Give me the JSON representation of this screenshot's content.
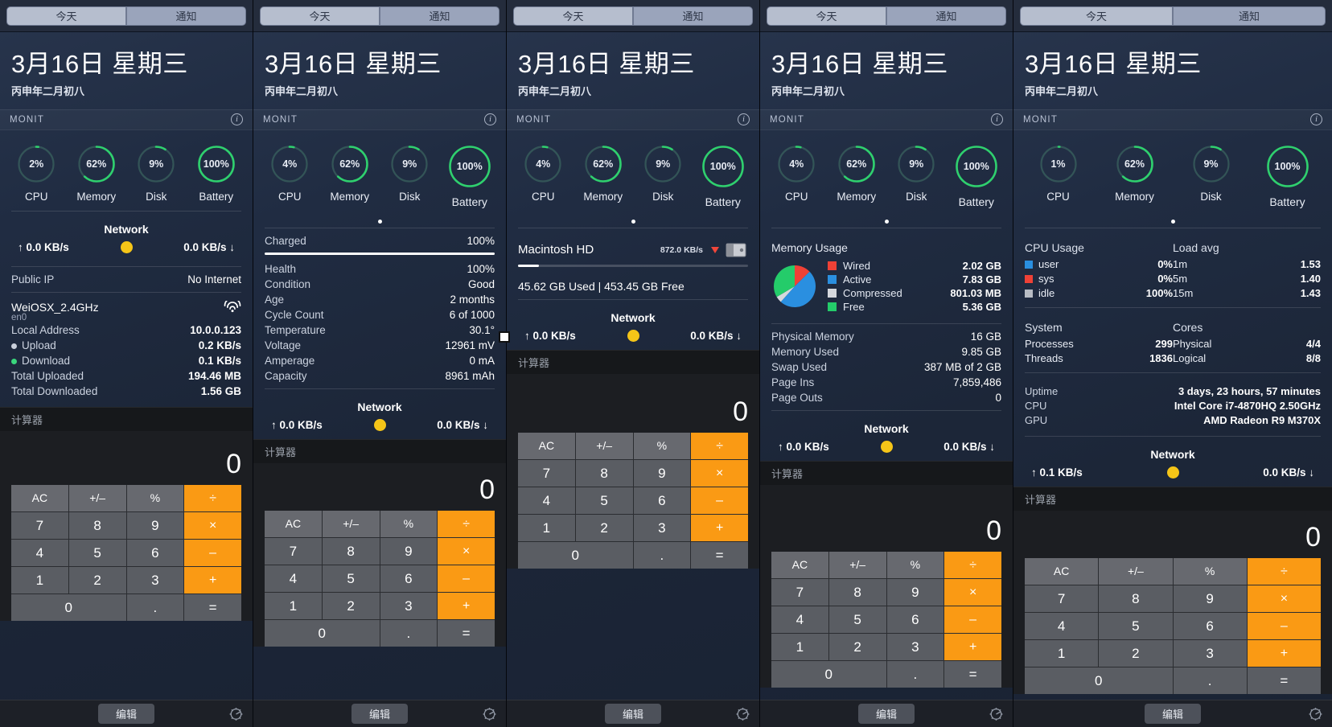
{
  "tabs": {
    "today": "今天",
    "notifications": "通知"
  },
  "date": {
    "main": "3月16日 星期三",
    "lunar": "丙申年二月初八"
  },
  "widget": {
    "name": "MONIT",
    "info_icon": "info-icon"
  },
  "calculator": {
    "title": "计算器",
    "display": "0",
    "keys": [
      "AC",
      "+/–",
      "%",
      "÷",
      "7",
      "8",
      "9",
      "×",
      "4",
      "5",
      "6",
      "–",
      "1",
      "2",
      "3",
      "+",
      "0",
      ".",
      "="
    ]
  },
  "bottom": {
    "edit": "编辑",
    "gear_icon": "gear-icon"
  },
  "common": {
    "network_title": "Network",
    "gauge_labels": [
      "CPU",
      "Memory",
      "Disk",
      "Battery"
    ],
    "orb_color": "#f5c518"
  },
  "panels": [
    {
      "id": "panel-network",
      "gauges": [
        {
          "label": "CPU",
          "value": "2%",
          "pct": 2
        },
        {
          "label": "Memory",
          "value": "62%",
          "pct": 62
        },
        {
          "label": "Disk",
          "value": "9%",
          "pct": 9
        },
        {
          "label": "Battery",
          "value": "100%",
          "pct": 100
        }
      ],
      "network": {
        "up": "↑ 0.0 KB/s",
        "down": "0.0 KB/s ↓"
      },
      "public_ip": {
        "key": "Public IP",
        "value": "No Internet"
      },
      "iface": {
        "ssid": "WeiOSX_2.4GHz",
        "device": "en0",
        "wifi_icon": "wifi-icon",
        "rows": [
          {
            "key": "Local Address",
            "value": "10.0.0.123",
            "dot": ""
          },
          {
            "key": "Upload",
            "value": "0.2 KB/s",
            "dot": "up"
          },
          {
            "key": "Download",
            "value": "0.1 KB/s",
            "dot": "down"
          },
          {
            "key": "Total Uploaded",
            "value": "194.46 MB",
            "dot": ""
          },
          {
            "key": "Total Downloaded",
            "value": "1.56 GB",
            "dot": ""
          }
        ]
      }
    },
    {
      "id": "panel-battery",
      "gauges": [
        {
          "label": "CPU",
          "value": "4%",
          "pct": 4
        },
        {
          "label": "Memory",
          "value": "62%",
          "pct": 62
        },
        {
          "label": "Disk",
          "value": "9%",
          "pct": 9
        },
        {
          "label": "Battery",
          "value": "100%",
          "pct": 100
        }
      ],
      "charged": {
        "key": "Charged",
        "value": "100%",
        "pct": 100
      },
      "rows": [
        {
          "key": "Health",
          "value": "100%"
        },
        {
          "key": "Condition",
          "value": "Good"
        },
        {
          "key": "Age",
          "value": "2 months"
        },
        {
          "key": "Cycle Count",
          "value": "6 of 1000"
        },
        {
          "key": "Temperature",
          "value": "30.1°"
        },
        {
          "key": "Voltage",
          "value": "12961 mV"
        },
        {
          "key": "Amperage",
          "value": "0 mA"
        },
        {
          "key": "Capacity",
          "value": "8961 mAh"
        }
      ],
      "network": {
        "up": "↑ 0.0 KB/s",
        "down": "0.0 KB/s ↓"
      }
    },
    {
      "id": "panel-disk",
      "gauges": [
        {
          "label": "CPU",
          "value": "4%",
          "pct": 4
        },
        {
          "label": "Memory",
          "value": "62%",
          "pct": 62
        },
        {
          "label": "Disk",
          "value": "9%",
          "pct": 9
        },
        {
          "label": "Battery",
          "value": "100%",
          "pct": 100
        }
      ],
      "disk": {
        "name": "Macintosh HD",
        "rate": "872.0 KB/s",
        "icon": "hard-drive-icon",
        "used_pct": 9,
        "summary": "45.62 GB Used  |  453.45 GB Free"
      },
      "network": {
        "up": "↑ 0.0 KB/s",
        "down": "0.0 KB/s ↓"
      }
    },
    {
      "id": "panel-memory",
      "gauges": [
        {
          "label": "CPU",
          "value": "4%",
          "pct": 4
        },
        {
          "label": "Memory",
          "value": "62%",
          "pct": 62
        },
        {
          "label": "Disk",
          "value": "9%",
          "pct": 9
        },
        {
          "label": "Battery",
          "value": "100%",
          "pct": 100
        }
      ],
      "memory": {
        "title": "Memory Usage",
        "legend": [
          {
            "name": "Wired",
            "value": "2.02 GB",
            "color": "#ef4136"
          },
          {
            "name": "Active",
            "value": "7.83 GB",
            "color": "#2a8fe0"
          },
          {
            "name": "Compressed",
            "value": "801.03 MB",
            "color": "#d5d8dd"
          },
          {
            "name": "Free",
            "value": "5.36 GB",
            "color": "#24cc6a"
          }
        ]
      },
      "rows": [
        {
          "key": "Physical Memory",
          "value": "16 GB"
        },
        {
          "key": "Memory Used",
          "value": "9.85 GB"
        },
        {
          "key": "Swap Used",
          "value": "387 MB of 2 GB"
        },
        {
          "key": "Page Ins",
          "value": "7,859,486"
        },
        {
          "key": "Page Outs",
          "value": "0"
        }
      ],
      "network": {
        "up": "↑ 0.0 KB/s",
        "down": "0.0 KB/s ↓"
      }
    },
    {
      "id": "panel-cpu",
      "gauges": [
        {
          "label": "CPU",
          "value": "1%",
          "pct": 1
        },
        {
          "label": "Memory",
          "value": "62%",
          "pct": 62
        },
        {
          "label": "Disk",
          "value": "9%",
          "pct": 9
        },
        {
          "label": "Battery",
          "value": "100%",
          "pct": 100
        }
      ],
      "cpu_usage": {
        "title": "CPU Usage",
        "rows": [
          {
            "name": "user",
            "value": "0%",
            "color": "#2a8fe0"
          },
          {
            "name": "sys",
            "value": "0%",
            "color": "#ef4136"
          },
          {
            "name": "idle",
            "value": "100%",
            "color": "#b8bcc4"
          }
        ]
      },
      "load_avg": {
        "title": "Load avg",
        "rows": [
          {
            "name": "1m",
            "value": "1.53"
          },
          {
            "name": "5m",
            "value": "1.40"
          },
          {
            "name": "15m",
            "value": "1.43"
          }
        ]
      },
      "system": {
        "title": "System",
        "rows": [
          {
            "name": "Processes",
            "value": "299"
          },
          {
            "name": "Threads",
            "value": "1836"
          }
        ]
      },
      "cores": {
        "title": "Cores",
        "rows": [
          {
            "name": "Physical",
            "value": "4/4"
          },
          {
            "name": "Logical",
            "value": "8/8"
          }
        ]
      },
      "info_rows": [
        {
          "key": "Uptime",
          "value": "3 days, 23 hours, 57 minutes"
        },
        {
          "key": "CPU",
          "value": "Intel Core i7-4870HQ 2.50GHz"
        },
        {
          "key": "GPU",
          "value": "AMD Radeon R9 M370X"
        }
      ],
      "network": {
        "up": "↑ 0.1 KB/s",
        "down": "0.0 KB/s ↓"
      }
    }
  ]
}
